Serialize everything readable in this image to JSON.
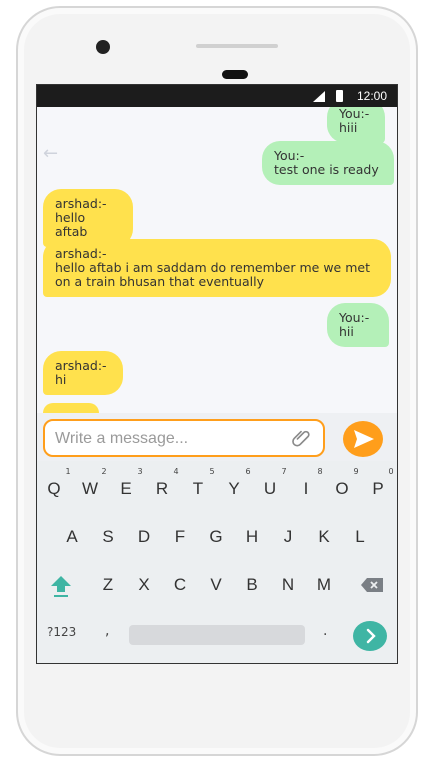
{
  "status_bar": {
    "time": "12:00"
  },
  "messages": [
    {
      "sender": "You:-",
      "text": "hiii",
      "side": "me"
    },
    {
      "sender": "You:-",
      "text": "test one is ready",
      "side": "me"
    },
    {
      "sender": "arshad:-",
      "text": "hello aftab",
      "side": "them"
    },
    {
      "sender": "arshad:-",
      "text": "hello aftab i am saddam do remember me we met\non a train bhusan that eventually",
      "side": "them"
    },
    {
      "sender": "You:-",
      "text": "hii",
      "side": "me"
    },
    {
      "sender": "arshad:-",
      "text": "hi",
      "side": "them"
    }
  ],
  "composer": {
    "placeholder": "Write a message..."
  },
  "keyboard": {
    "row1": [
      "Q",
      "W",
      "E",
      "R",
      "T",
      "Y",
      "U",
      "I",
      "O",
      "P"
    ],
    "row1_hints": [
      "1",
      "2",
      "3",
      "4",
      "5",
      "6",
      "7",
      "8",
      "9",
      "0"
    ],
    "row2": [
      "A",
      "S",
      "D",
      "F",
      "G",
      "H",
      "J",
      "K",
      "L"
    ],
    "row3": [
      "Z",
      "X",
      "C",
      "V",
      "B",
      "N",
      "M"
    ],
    "symbols_label": "?123",
    "comma": ",",
    "period": "."
  },
  "colors": {
    "my_bubble": "#b4f0b8",
    "their_bubble": "#ffe14d",
    "accent": "#ff9e1b",
    "enter": "#3fb5a4"
  }
}
